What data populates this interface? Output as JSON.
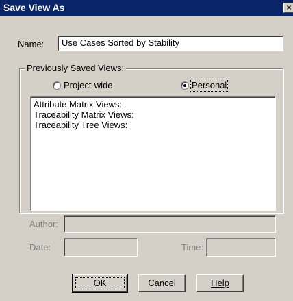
{
  "dialog": {
    "title": "Save View As",
    "close_glyph": "×"
  },
  "name": {
    "label": "Name:",
    "value": "Use Cases Sorted by Stability"
  },
  "group": {
    "label": "Previously Saved Views:"
  },
  "radios": {
    "project_wide": {
      "label": "Project-wide",
      "selected": false
    },
    "personal": {
      "label": "Personal",
      "selected": true
    }
  },
  "views_list": [
    "Attribute Matrix Views:",
    "Traceability Matrix Views:",
    "Traceability Tree Views:"
  ],
  "fields": {
    "author_label": "Author:",
    "author_value": "",
    "date_label": "Date:",
    "date_value": "",
    "time_label": "Time:",
    "time_value": ""
  },
  "buttons": {
    "ok": "OK",
    "cancel": "Cancel",
    "help": "Help"
  }
}
